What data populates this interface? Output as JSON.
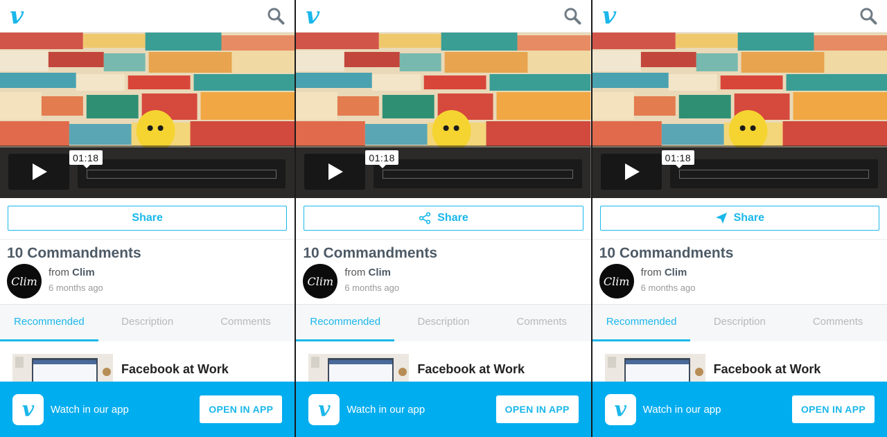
{
  "panels": [
    {
      "brand": "v",
      "search_icon": "search-icon",
      "video": {
        "time": "01:18",
        "play_icon": "play-icon"
      },
      "share": {
        "label": "Share",
        "icon": "none"
      },
      "title": "10 Commandments",
      "author": {
        "prefix": "from",
        "name": "Clim",
        "avatar_text": "Clim",
        "posted": "6 months ago"
      },
      "tabs": [
        {
          "label": "Recommended"
        },
        {
          "label": "Description"
        },
        {
          "label": "Comments"
        }
      ],
      "recommended": [
        {
          "title": "Facebook at Work"
        }
      ],
      "banner": {
        "icon_text": "v",
        "text": "Watch in our app",
        "button": "OPEN IN APP"
      }
    },
    {
      "brand": "v",
      "search_icon": "search-icon",
      "video": {
        "time": "01:18",
        "play_icon": "play-icon"
      },
      "share": {
        "label": "Share",
        "icon": "share-nodes-icon"
      },
      "title": "10 Commandments",
      "author": {
        "prefix": "from",
        "name": "Clim",
        "avatar_text": "Clim",
        "posted": "6 months ago"
      },
      "tabs": [
        {
          "label": "Recommended"
        },
        {
          "label": "Description"
        },
        {
          "label": "Comments"
        }
      ],
      "recommended": [
        {
          "title": "Facebook at Work"
        }
      ],
      "banner": {
        "icon_text": "v",
        "text": "Watch in our app",
        "button": "OPEN IN APP"
      }
    },
    {
      "brand": "v",
      "search_icon": "search-icon",
      "video": {
        "time": "01:18",
        "play_icon": "play-icon"
      },
      "share": {
        "label": "Share",
        "icon": "paper-plane-icon"
      },
      "title": "10 Commandments",
      "author": {
        "prefix": "from",
        "name": "Clim",
        "avatar_text": "Clim",
        "posted": "6 months ago"
      },
      "tabs": [
        {
          "label": "Recommended"
        },
        {
          "label": "Description"
        },
        {
          "label": "Comments"
        }
      ],
      "recommended": [
        {
          "title": "Facebook at Work"
        }
      ],
      "banner": {
        "icon_text": "v",
        "text": "Watch in our app",
        "button": "OPEN IN APP"
      }
    }
  ],
  "colors": {
    "accent": "#1ab7ea",
    "banner": "#00adef",
    "title": "#4d5a66"
  }
}
